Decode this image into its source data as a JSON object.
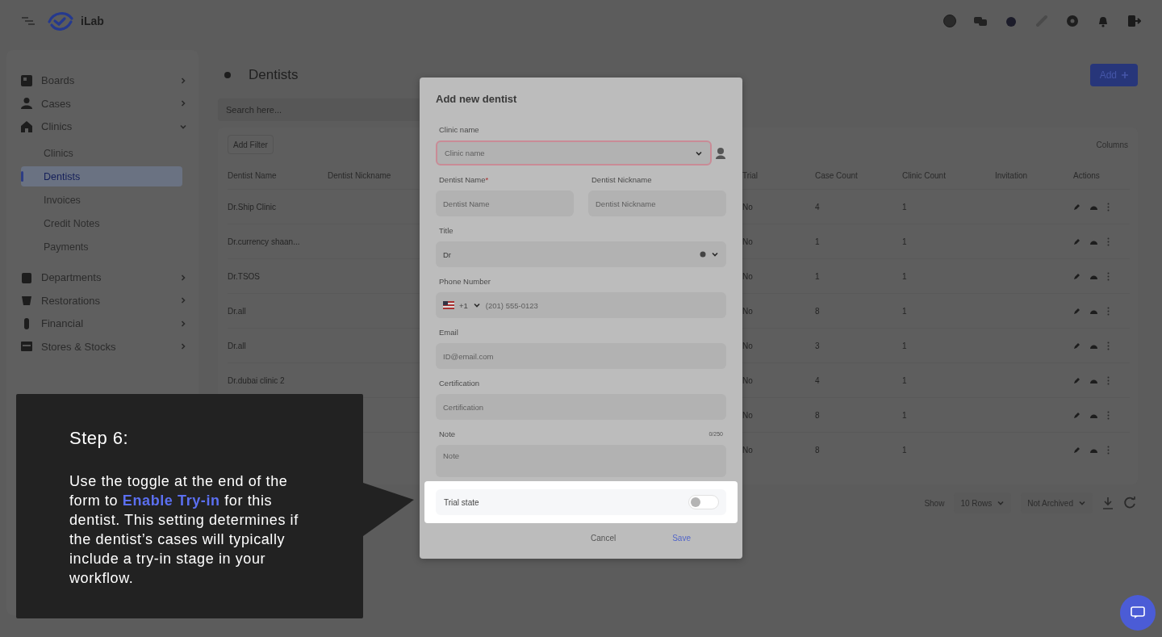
{
  "top_bar": {
    "app_name": "iLab"
  },
  "sidebar": {
    "items": [
      {
        "label": "Boards",
        "expanded": false
      },
      {
        "label": "Cases",
        "expanded": false
      },
      {
        "label": "Clinics",
        "expanded": true,
        "children": [
          {
            "label": "Clinics",
            "selected": false
          },
          {
            "label": "Dentists",
            "selected": true
          },
          {
            "label": "Invoices",
            "selected": false
          },
          {
            "label": "Credit Notes",
            "selected": false
          },
          {
            "label": "Payments",
            "selected": false
          }
        ]
      },
      {
        "label": "Departments",
        "expanded": false
      },
      {
        "label": "Restorations",
        "expanded": false
      },
      {
        "label": "Financial",
        "expanded": false
      },
      {
        "label": "Stores & Stocks",
        "expanded": false
      }
    ]
  },
  "page": {
    "title": "Dentists",
    "add_button": "Add",
    "search": {
      "placeholder": "Search here..."
    },
    "add_filter": "Add Filter",
    "columns_button": "Columns",
    "table": {
      "columns": [
        "Dentist Name",
        "Dentist Nickname",
        "Trial",
        "Case Count",
        "Clinic Count",
        "Invitation",
        "Actions"
      ],
      "rows": [
        {
          "name": "Dr.Ship Clinic",
          "trial": "No",
          "case_count": "4",
          "clinic_count": "1"
        },
        {
          "name": "Dr.currency shaan...",
          "trial": "No",
          "case_count": "1",
          "clinic_count": "1"
        },
        {
          "name": "Dr.TSOS",
          "trial": "No",
          "case_count": "1",
          "clinic_count": "1"
        },
        {
          "name": "Dr.all",
          "trial": "No",
          "case_count": "8",
          "clinic_count": "1"
        },
        {
          "name": "Dr.all",
          "trial": "No",
          "case_count": "3",
          "clinic_count": "1"
        },
        {
          "name": "Dr.dubai clinic 2",
          "trial": "No",
          "case_count": "4",
          "clinic_count": "1"
        },
        {
          "trial": "No",
          "case_count": "8",
          "clinic_count": "1"
        },
        {
          "trial": "No",
          "case_count": "8",
          "clinic_count": "1"
        }
      ]
    },
    "footer": {
      "show_label": "Show",
      "rows_select": "10 Rows",
      "archive_select": "Not Archived"
    }
  },
  "dialog": {
    "title": "Add new dentist",
    "clinic": {
      "label": "Clinic name",
      "placeholder": "Clinic name",
      "invalid": true
    },
    "dentist_name": {
      "label": "Dentist Name",
      "required_mark": "*",
      "placeholder": "Dentist Name"
    },
    "dentist_nickname": {
      "label": "Dentist Nickname",
      "placeholder": "Dentist Nickname"
    },
    "title_field": {
      "label": "Title",
      "value": "Dr"
    },
    "phone": {
      "label": "Phone Number",
      "code": "+1",
      "placeholder": "(201) 555-0123"
    },
    "email": {
      "label": "Email",
      "placeholder": "ID@email.com"
    },
    "certification": {
      "label": "Certification",
      "placeholder": "Certification"
    },
    "note": {
      "label": "Note",
      "counter": "0/250",
      "placeholder": "Note"
    },
    "trial": {
      "label": "Trial state",
      "on": false
    },
    "cancel": "Cancel",
    "save": "Save"
  },
  "guide": {
    "title": "Step 6:",
    "body": "Use the toggle at the end of the form to **Enable Try-in** for this dentist. This setting determines if the dentist’s cases will typically include a try-in stage in your workflow."
  }
}
